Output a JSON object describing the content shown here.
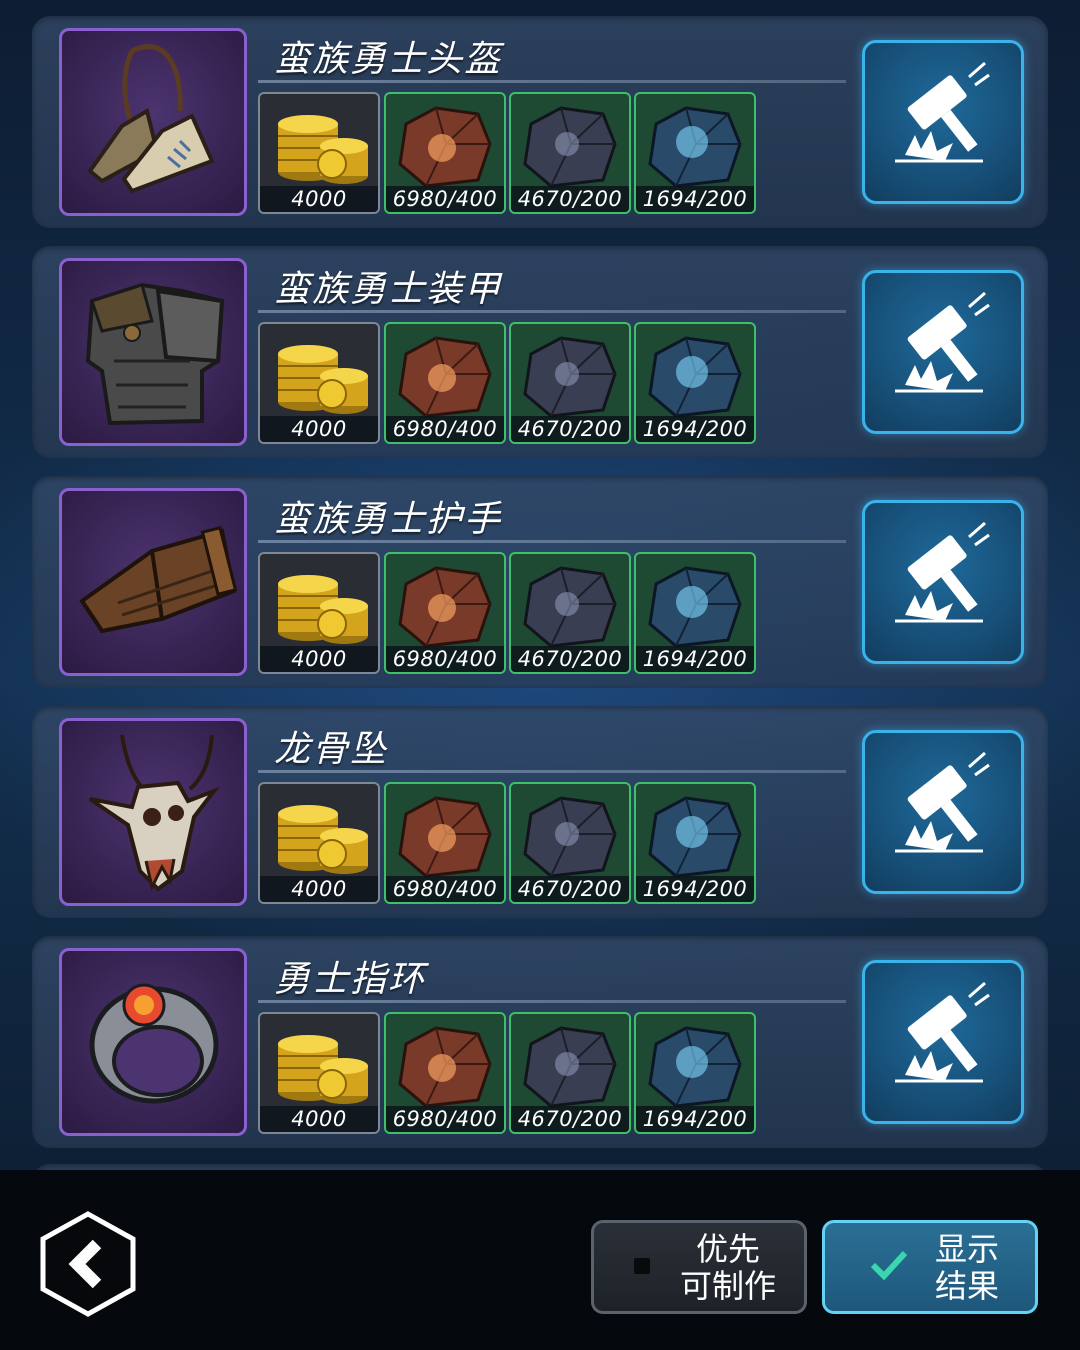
{
  "items": [
    {
      "name": "蛮族勇士头盔",
      "icon": "boots-icon",
      "costs": [
        "4000",
        "6980/400",
        "4670/200",
        "1694/200"
      ]
    },
    {
      "name": "蛮族勇士装甲",
      "icon": "armor-icon",
      "costs": [
        "4000",
        "6980/400",
        "4670/200",
        "1694/200"
      ]
    },
    {
      "name": "蛮族勇士护手",
      "icon": "bracer-icon",
      "costs": [
        "4000",
        "6980/400",
        "4670/200",
        "1694/200"
      ]
    },
    {
      "name": "龙骨坠",
      "icon": "skull-pendant-icon",
      "costs": [
        "4000",
        "6980/400",
        "4670/200",
        "1694/200"
      ]
    },
    {
      "name": "勇士指环",
      "icon": "ring-icon",
      "costs": [
        "4000",
        "6980/400",
        "4670/200",
        "1694/200"
      ]
    }
  ],
  "material_icons": [
    "gold-coins-icon",
    "copper-ore-icon",
    "iron-ore-icon",
    "crystal-ore-icon"
  ],
  "craft_icon": "hammer-icon",
  "footer": {
    "back_icon": "back-arrow-icon",
    "priority_line1": "优先",
    "priority_line2": "可制作",
    "priority_checked": false,
    "results_line1": "显示",
    "results_line2": "结果",
    "results_checked": true
  },
  "colors": {
    "item_border": "#8a5fd0",
    "ore_border": "#3fbf6a",
    "craft_border": "#3ab3ea",
    "check": "#3ad6b0"
  }
}
